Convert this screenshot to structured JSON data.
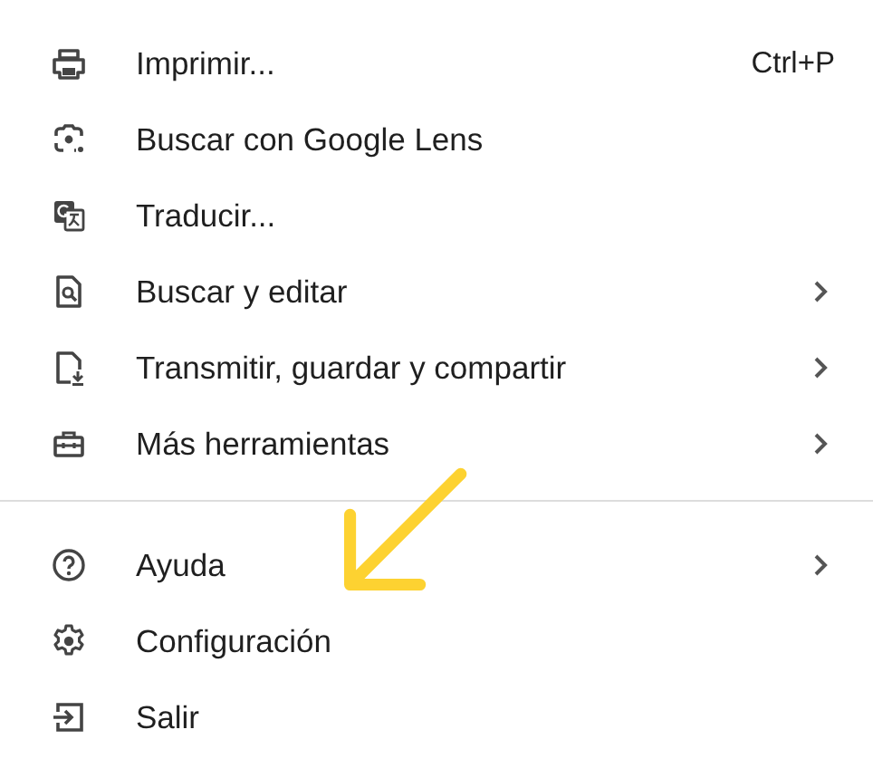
{
  "menu": {
    "sections": [
      {
        "items": [
          {
            "label": "Imprimir...",
            "shortcut": "Ctrl+P",
            "has_submenu": false
          },
          {
            "label": "Buscar con Google Lens",
            "has_submenu": false
          },
          {
            "label": "Traducir...",
            "has_submenu": false
          },
          {
            "label": "Buscar y editar",
            "has_submenu": true
          },
          {
            "label": "Transmitir, guardar y compartir",
            "has_submenu": true
          },
          {
            "label": "Más herramientas",
            "has_submenu": true
          }
        ]
      },
      {
        "items": [
          {
            "label": "Ayuda",
            "has_submenu": true
          },
          {
            "label": "Configuración",
            "has_submenu": false
          },
          {
            "label": "Salir",
            "has_submenu": false
          }
        ]
      }
    ]
  }
}
